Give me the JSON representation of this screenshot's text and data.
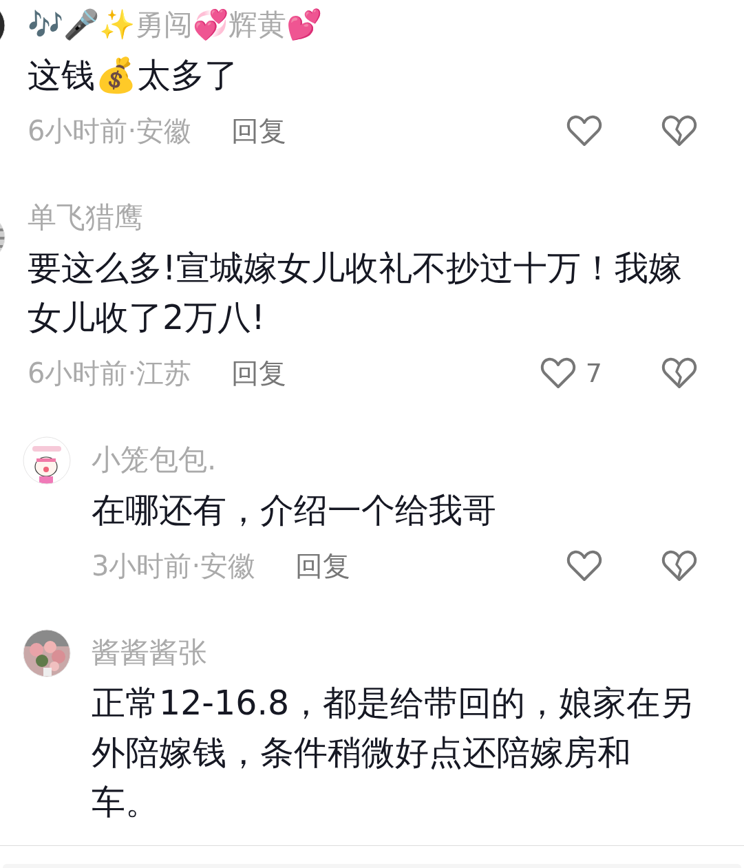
{
  "comments": [
    {
      "kind": "top",
      "name": "🎶🎤✨勇闯💞辉黄💕",
      "text": "这钱💰太多了",
      "time": "6小时前",
      "separator": "·",
      "location": "安徽",
      "reply_label": "回复"
    },
    {
      "kind": "top",
      "name": "单飞猎鹰",
      "text": "要这么多!宣城嫁女儿收礼不抄过十万！我嫁女儿收了2万八!",
      "time": "6小时前",
      "separator": "·",
      "location": "江苏",
      "reply_label": "回复",
      "likes": "7"
    },
    {
      "kind": "reply",
      "name": "小笼包包.",
      "text": "在哪还有，介绍一个给我哥",
      "time": "3小时前",
      "separator": "·",
      "location": "安徽",
      "reply_label": "回复"
    },
    {
      "kind": "reply",
      "name": "酱酱酱张",
      "text": "正常12-16.8，都是给带回的，娘家在另外陪嫁钱，条件稍微好点还陪嫁房和车。"
    }
  ]
}
